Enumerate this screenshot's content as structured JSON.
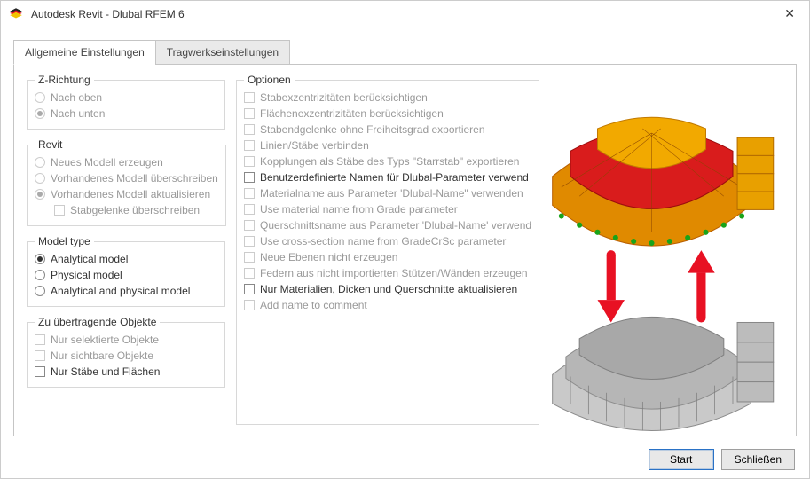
{
  "window": {
    "title": "Autodesk Revit - Dlubal RFEM 6"
  },
  "tabs": {
    "t0": "Allgemeine Einstellungen",
    "t1": "Tragwerkseinstellungen"
  },
  "zrichtung": {
    "legend": "Z-Richtung",
    "up": "Nach oben",
    "down": "Nach unten"
  },
  "revit": {
    "legend": "Revit",
    "new": "Neues Modell erzeugen",
    "overwrite": "Vorhandenes Modell überschreiben",
    "update": "Vorhandenes Modell aktualisieren",
    "hinges": "Stabgelenke überschreiben"
  },
  "modeltype": {
    "legend": "Model type",
    "analytical": "Analytical model",
    "physical": "Physical model",
    "both": "Analytical and physical model"
  },
  "transfer": {
    "legend": "Zu übertragende Objekte",
    "selected": "Nur selektierte Objekte",
    "visible": "Nur sichtbare Objekte",
    "bars": "Nur Stäbe und Flächen"
  },
  "options": {
    "legend": "Optionen",
    "o0": "Stabexzentrizitäten berücksichtigen",
    "o1": "Flächenexzentrizitäten berücksichtigen",
    "o2": "Stabendgelenke ohne Freiheitsgrad exportieren",
    "o3": "Linien/Stäbe verbinden",
    "o4": "Kopplungen als Stäbe des Typs \"Starrstab\" exportieren",
    "o5": "Benutzerdefinierte Namen für Dlubal-Parameter verwend",
    "o6": "Materialname aus Parameter 'Dlubal-Name\" verwenden",
    "o7": "Use material name from Grade parameter",
    "o8": "Querschnittsname aus Parameter 'Dlubal-Name' verwend",
    "o9": "Use cross-section name from GradeCrSc parameter",
    "o10": "Neue Ebenen nicht erzeugen",
    "o11": "Federn aus nicht importierten Stützen/Wänden erzeugen",
    "o12": "Nur Materialien, Dicken und Querschnitte aktualisieren",
    "o13": "Add name to comment"
  },
  "footer": {
    "start": "Start",
    "close": "Schließen"
  }
}
